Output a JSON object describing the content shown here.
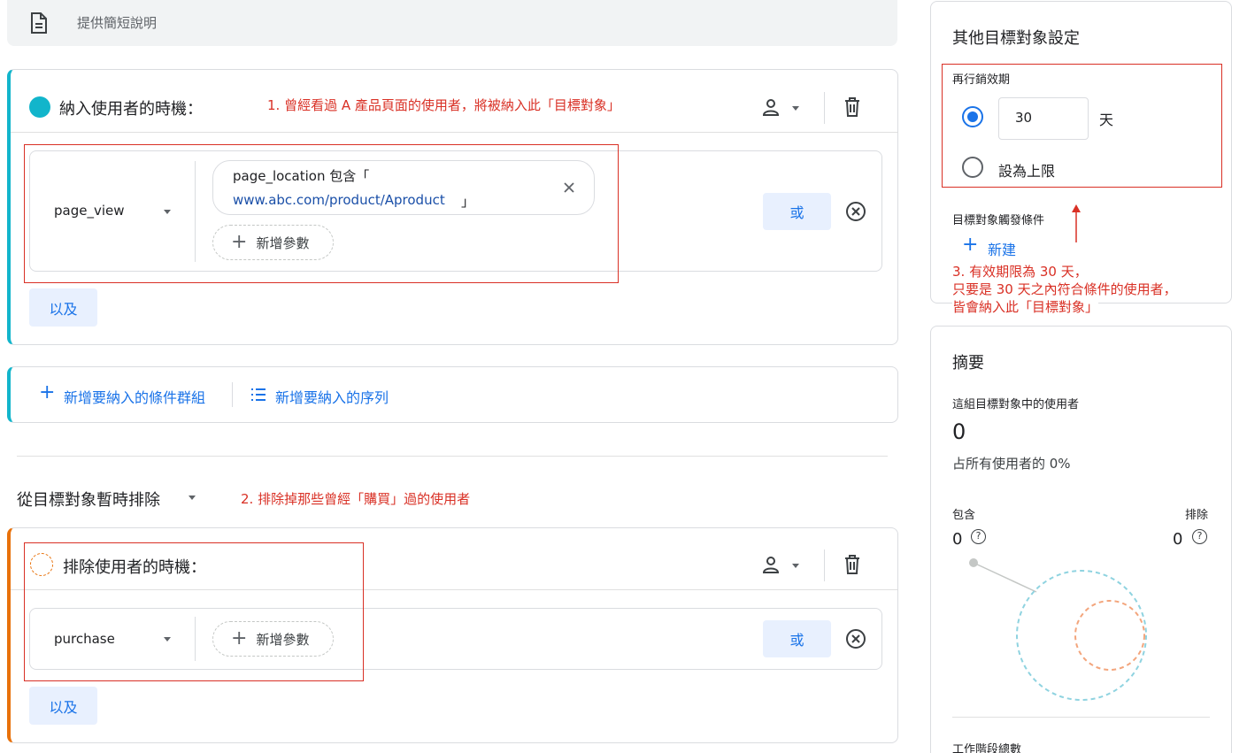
{
  "description_bar": {
    "placeholder": "提供簡短說明"
  },
  "include_group": {
    "title": "納入使用者的時機：",
    "annotation": "1. 曾經看過 A 產品頁面的使用者，將被納入此「目標對象」",
    "event": "page_view",
    "param_line1": "page_location 包含「",
    "param_url": "www.abc.com/product/Aproduct",
    "param_close_bracket": "」",
    "add_param": "新增參數",
    "or_label": "或",
    "and_label": "以及"
  },
  "add_actions": {
    "add_group": "新增要納入的條件群組",
    "add_sequence": "新增要納入的序列"
  },
  "exclude_section": {
    "header": "從目標對象暫時排除",
    "annotation": "2. 排除掉那些曾經「購買」過的使用者",
    "title": "排除使用者的時機：",
    "event": "purchase",
    "add_param": "新增參數",
    "or_label": "或",
    "and_label": "以及"
  },
  "settings_panel": {
    "title": "其他目標對象設定",
    "expiry_label": "再行銷效期",
    "days_value": "30",
    "days_unit": "天",
    "max_label": "設為上限",
    "trigger_label": "目標對象觸發條件",
    "new_label": "新建",
    "annotation_lines": [
      "3. 有效期限為 30 天，",
      "只要是 30 天之內符合條件的使用者，",
      "皆會納入此「目標對象」"
    ]
  },
  "summary_panel": {
    "title": "摘要",
    "users_label": "這組目標對象中的使用者",
    "users_value": "0",
    "percent_text": "占所有使用者的 0%",
    "include_label": "包含",
    "include_value": "0",
    "exclude_label": "排除",
    "exclude_value": "0",
    "sessions_label": "工作階段總數"
  },
  "colors": {
    "accent_teal": "#12b5cb",
    "accent_orange": "#e8710a",
    "annotation_red": "#d93025",
    "link_blue": "#1a73e8"
  }
}
